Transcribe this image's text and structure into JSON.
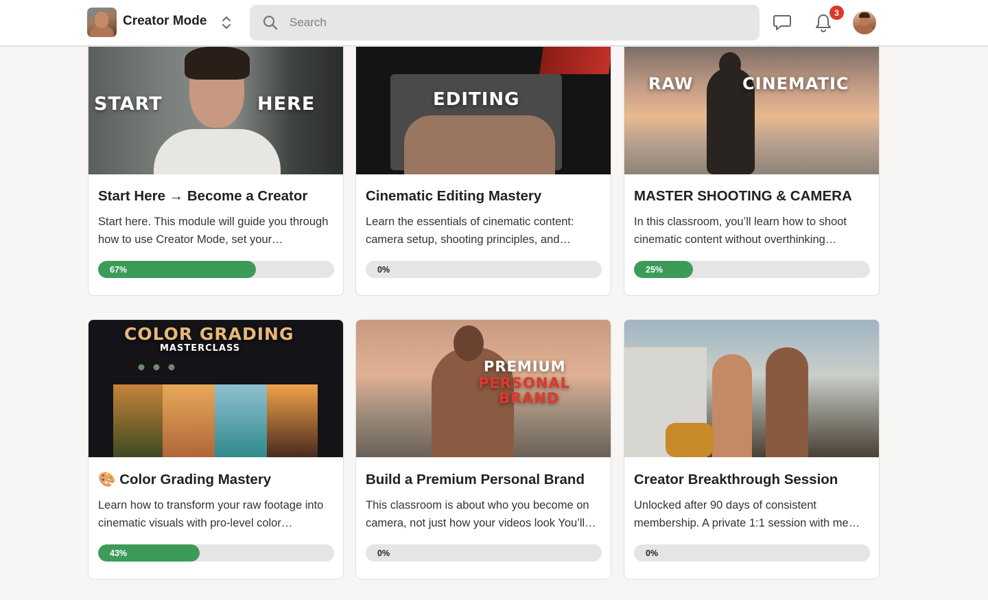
{
  "header": {
    "brand_name": "Creator Mode",
    "search_placeholder": "Search",
    "notification_count": "3"
  },
  "icons": {
    "brand": "community-avatar",
    "switch": "chevron-up-down-icon",
    "search": "search-icon",
    "chat": "chat-bubble-icon",
    "bell": "bell-icon",
    "user": "user-avatar"
  },
  "colors": {
    "progress_fill": "#3d9b5a",
    "progress_track": "#e5e5e5",
    "badge": "#d93a2b"
  },
  "courses": [
    {
      "thumb_text": [
        "START",
        "HERE"
      ],
      "title": "Start Here → Become a Creator",
      "description": "Start here. This module will guide you through how to use Creator Mode, set your…",
      "progress": 67,
      "progress_label": "67%"
    },
    {
      "thumb_text": [
        "EDITING"
      ],
      "title": "Cinematic Editing Mastery",
      "description": "Learn the essentials of cinematic content: camera setup, shooting principles, and…",
      "progress": 0,
      "progress_label": "0%"
    },
    {
      "thumb_text": [
        "RAW",
        "CINEMATIC"
      ],
      "title": "MASTER SHOOTING & CAMERA",
      "description": "In this classroom, you’ll learn how to shoot cinematic content without overthinking…",
      "progress": 25,
      "progress_label": "25%"
    },
    {
      "thumb_text": [
        "COLOR GRADING",
        "MASTERCLASS"
      ],
      "title": "🎨 Color Grading Mastery",
      "description": "Learn how to transform your raw footage into cinematic visuals with pro-level color…",
      "progress": 43,
      "progress_label": "43%"
    },
    {
      "thumb_text": [
        "PREMIUM",
        "PERSONAL",
        "BRAND"
      ],
      "title": "Build a Premium Personal Brand",
      "description": "This classroom is about who you become on camera, not just how your videos look You’ll…",
      "progress": 0,
      "progress_label": "0%"
    },
    {
      "thumb_text": [],
      "title": "Creator Breakthrough Session",
      "description": "Unlocked after 90 days of consistent membership. A private 1:1 session with me…",
      "progress": 0,
      "progress_label": "0%"
    }
  ]
}
